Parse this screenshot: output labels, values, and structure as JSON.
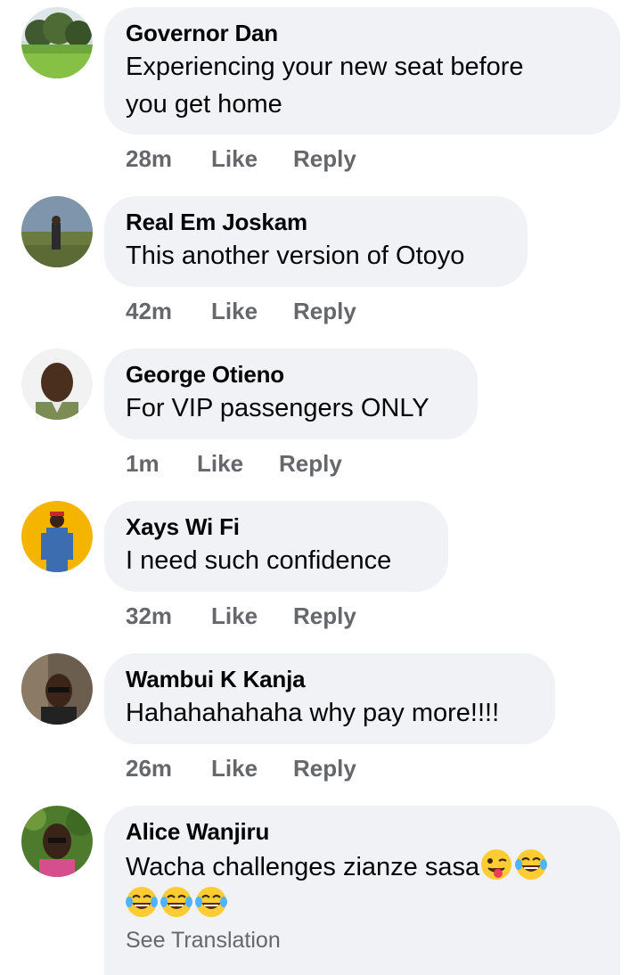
{
  "comments": [
    {
      "author": "Governor Dan",
      "text_lines": [
        "Experiencing your new seat before",
        "you get home"
      ],
      "time": "28m",
      "like": "Like",
      "reply": "Reply"
    },
    {
      "author": "Real Em Joskam",
      "text_lines": [
        "This another version of Otoyo"
      ],
      "time": "42m",
      "like": "Like",
      "reply": "Reply"
    },
    {
      "author": "George Otieno",
      "text_lines": [
        "For VIP passengers ONLY"
      ],
      "time": "1m",
      "like": "Like",
      "reply": "Reply"
    },
    {
      "author": "Xays Wi Fi",
      "text_lines": [
        "I need such confidence"
      ],
      "time": "32m",
      "like": "Like",
      "reply": "Reply"
    },
    {
      "author": "Wambui K Kanja",
      "text_lines": [
        "Hahahahahaha why pay more!!!!"
      ],
      "time": "26m",
      "like": "Like",
      "reply": "Reply"
    },
    {
      "author": "Alice Wanjiru",
      "text_lines": [
        "Wacha challenges zianze sasa"
      ],
      "emojis_line1": [
        "winking-tongue-emoji",
        "tears-of-joy-emoji"
      ],
      "emojis_line2": [
        "tears-of-joy-emoji",
        "tears-of-joy-emoji",
        "tears-of-joy-emoji"
      ],
      "see_translation": "See Translation"
    }
  ],
  "colors": {
    "bubble": "#f0f2f5",
    "meta": "#65676b",
    "text": "#050505"
  }
}
